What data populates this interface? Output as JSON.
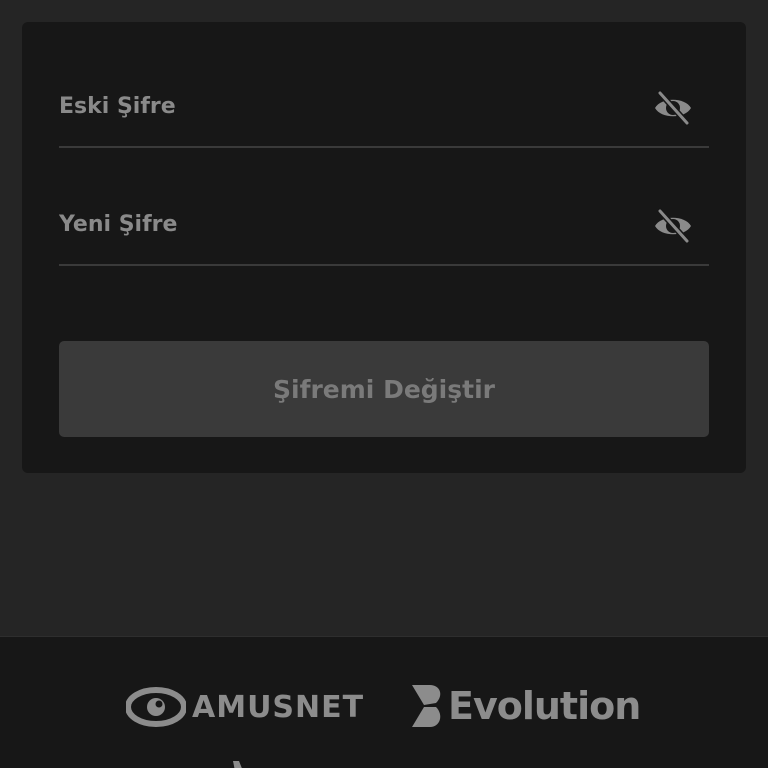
{
  "form": {
    "old_password_placeholder": "Eski Şifre",
    "new_password_placeholder": "Yeni Şifre",
    "submit_label": "Şifremi Değiştir"
  },
  "icons": {
    "toggle_visibility": "eye-off-icon"
  },
  "footer": {
    "logos": [
      {
        "name": "AMUSNET",
        "text": "AMUSNET"
      },
      {
        "name": "Evolution",
        "text": "Evolution"
      }
    ]
  },
  "colors": {
    "page_bg": "#252525",
    "card_bg": "#171717",
    "placeholder": "#8a8a8a",
    "button_bg": "#3a3a3a",
    "button_text": "#7a7a7a"
  }
}
